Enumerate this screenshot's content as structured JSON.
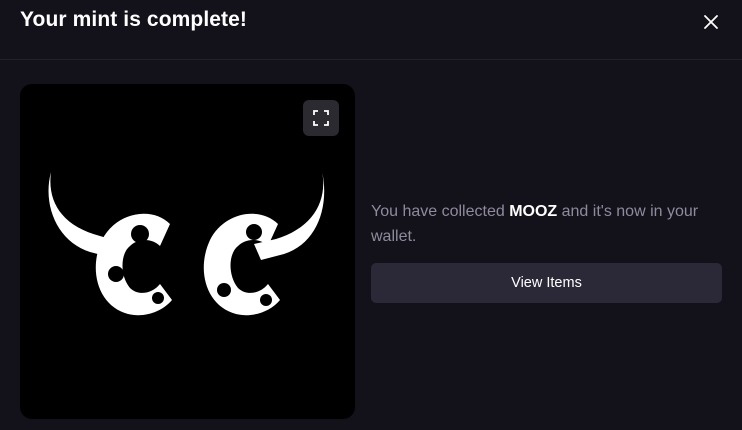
{
  "header": {
    "title": "Your mint is complete!",
    "close_icon": "close-icon"
  },
  "media": {
    "expand_icon": "expand-icon",
    "logo_text": "CC"
  },
  "message": {
    "prefix": "You have collected ",
    "collection": "MOOZ",
    "suffix": " and it's now in your wallet."
  },
  "actions": {
    "view_items_label": "View Items"
  },
  "colors": {
    "background": "#13111a",
    "button": "#2b2838",
    "muted_text": "#8f8b9d"
  }
}
